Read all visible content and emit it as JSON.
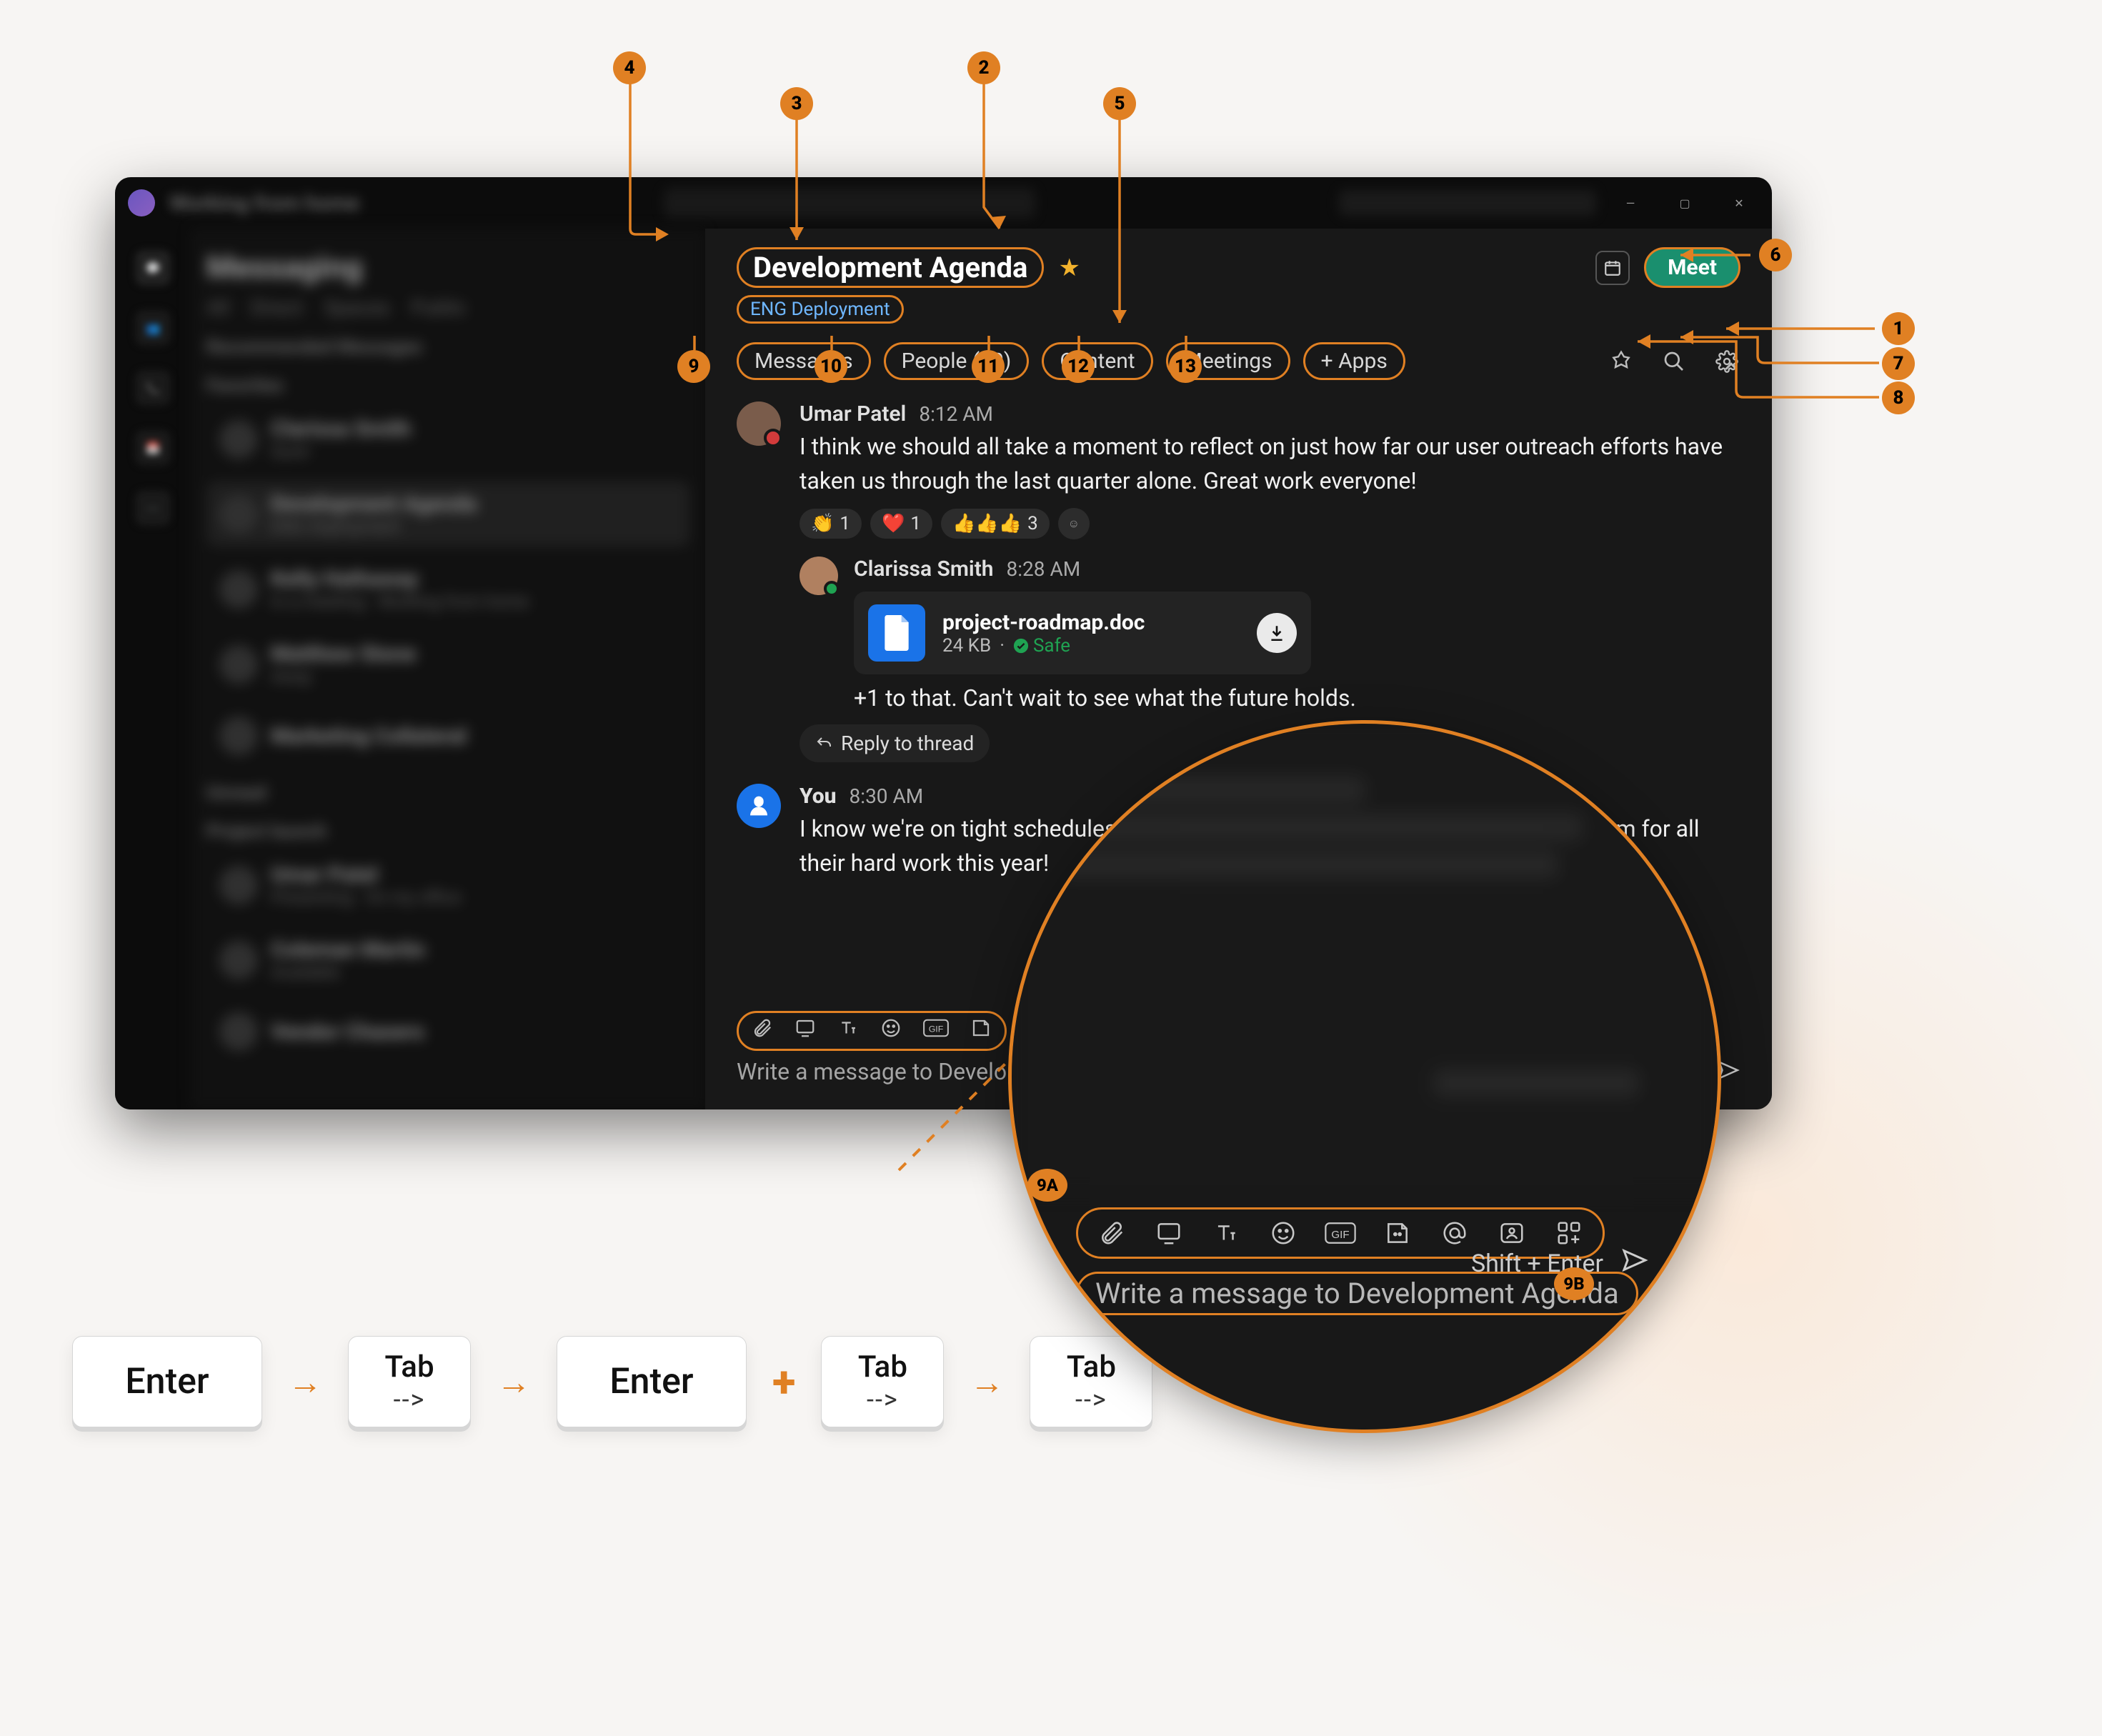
{
  "titlebar": {
    "status_label": "Working from home"
  },
  "space": {
    "title": "Development Agenda",
    "team_chip": "ENG Deployment",
    "schedule_tooltip": "Schedule",
    "meet_label": "Meet"
  },
  "tabs": {
    "messages": "Messages",
    "people": "People (30)",
    "content": "Content",
    "meetings": "Meetings",
    "apps": "+ Apps"
  },
  "feed": {
    "msg1": {
      "author": "Umar Patel",
      "time": "8:12 AM",
      "body": "I think we should all take a moment to reflect on just how far our user outreach efforts have taken us through the last quarter alone. Great work everyone!",
      "reactions": [
        {
          "emoji": "👏",
          "count": "1"
        },
        {
          "emoji": "❤️",
          "count": "1"
        },
        {
          "emoji": "👍👍👍",
          "count": "3"
        }
      ],
      "thread": {
        "author": "Clarissa Smith",
        "time": "8:28 AM",
        "file": {
          "name": "project-roadmap.doc",
          "size": "24 KB",
          "safe_label": "Safe"
        },
        "body": "+1 to that. Can't wait to see what the future holds."
      },
      "reply_btn": "Reply to thread"
    },
    "msg2": {
      "author": "You",
      "time": "8:30 AM",
      "body": "I know we're on tight schedules, and I wanted to send a big thank you to each team for all their hard work this year!"
    },
    "see_new": "See new messages"
  },
  "compose": {
    "placeholder": "Write a message to Development Agenda",
    "hint": "Shift + Enter",
    "mag_placeholder": "Write a message to Development Agenda"
  },
  "callouts": {
    "c1": "1",
    "c2": "2",
    "c3": "3",
    "c4": "4",
    "c5": "5",
    "c6": "6",
    "c7": "7",
    "c8": "8",
    "c9": "9",
    "c10": "10",
    "c11": "11",
    "c12": "12",
    "c13": "13",
    "c9a": "9A",
    "c9b": "9B"
  },
  "keys": {
    "enter": "Enter",
    "tab_top": "Tab",
    "tab_bottom": "-->",
    "arrow": "→",
    "plus": "+"
  }
}
